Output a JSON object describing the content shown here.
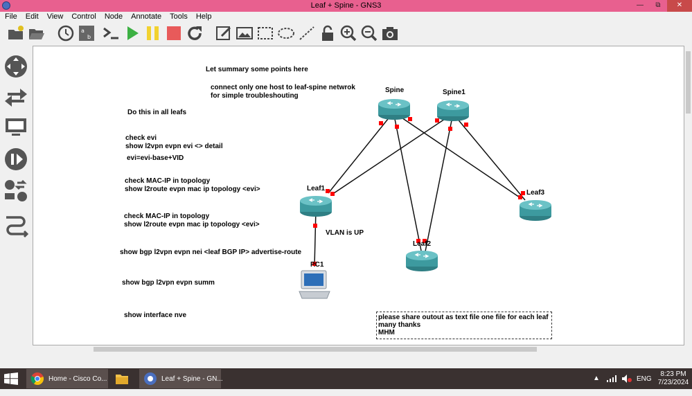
{
  "window": {
    "title": "Leaf + Spine - GNS3"
  },
  "menu": [
    "File",
    "Edit",
    "View",
    "Control",
    "Node",
    "Annotate",
    "Tools",
    "Help"
  ],
  "toolbar_icons": [
    "new-project-icon",
    "open-folder-icon",
    "snapshot-clock-icon",
    "console-all-icon",
    "terminal-icon",
    "start-all-icon",
    "suspend-all-icon",
    "stop-all-icon",
    "reload-all-icon",
    "add-note-icon",
    "insert-image-icon",
    "draw-rectangle-icon",
    "draw-ellipse-icon",
    "draw-line-icon",
    "lock-icon",
    "zoom-in-icon",
    "zoom-out-icon",
    "screenshot-icon"
  ],
  "dock_icons": [
    "routers-icon",
    "switches-icon",
    "end-devices-icon",
    "security-devices-icon",
    "all-devices-icon",
    "add-link-icon"
  ],
  "notes": {
    "summary": "Let summary some points here",
    "connect1": "connect only one host to leaf-spine netwrok",
    "connect2": "for simple troubleshouting",
    "do_this": "Do this in all leafs",
    "check_evi": "check evi",
    "show_evi": "show l2vpn evpn evi <> detail",
    "evi_formula": "evi=evi-base+VID",
    "check_mac1": "check MAC-IP in topology",
    "show_mac1": "show l2route evpn mac ip topology <evi>",
    "check_mac2": "check MAC-IP in topology",
    "show_mac2": "show l2route evpn mac ip topology <evi>",
    "bgp_nei": "show bgp l2vpn evpn nei <leaf BGP IP> advertise-route",
    "bgp_summ": "show bgp l2vpn evpn summ",
    "nve": "show interface nve",
    "vlan": "VLAN is UP",
    "share1": "please share outout as text file one file for each leaf",
    "share2": "many thanks",
    "share3": "MHM"
  },
  "nodes": {
    "spine": "Spine",
    "spine1": "Spine1",
    "leaf1": "Leaf1",
    "leaf2": "Leaf2",
    "leaf3": "Leaf3",
    "pc1": "PC1"
  },
  "colors": {
    "titlebar": "#e8608f",
    "router": "#3d9a9f",
    "link_status": "#ff0000",
    "taskbar": "#3a3130"
  },
  "taskbar": {
    "items": [
      {
        "label": "Home - Cisco Co...",
        "icon": "chrome-icon"
      },
      {
        "label": "",
        "icon": "file-explorer-icon"
      },
      {
        "label": "Leaf + Spine - GN...",
        "icon": "gns3-icon"
      }
    ],
    "lang": "ENG",
    "time": "8:23 PM",
    "date": "7/23/2024"
  }
}
